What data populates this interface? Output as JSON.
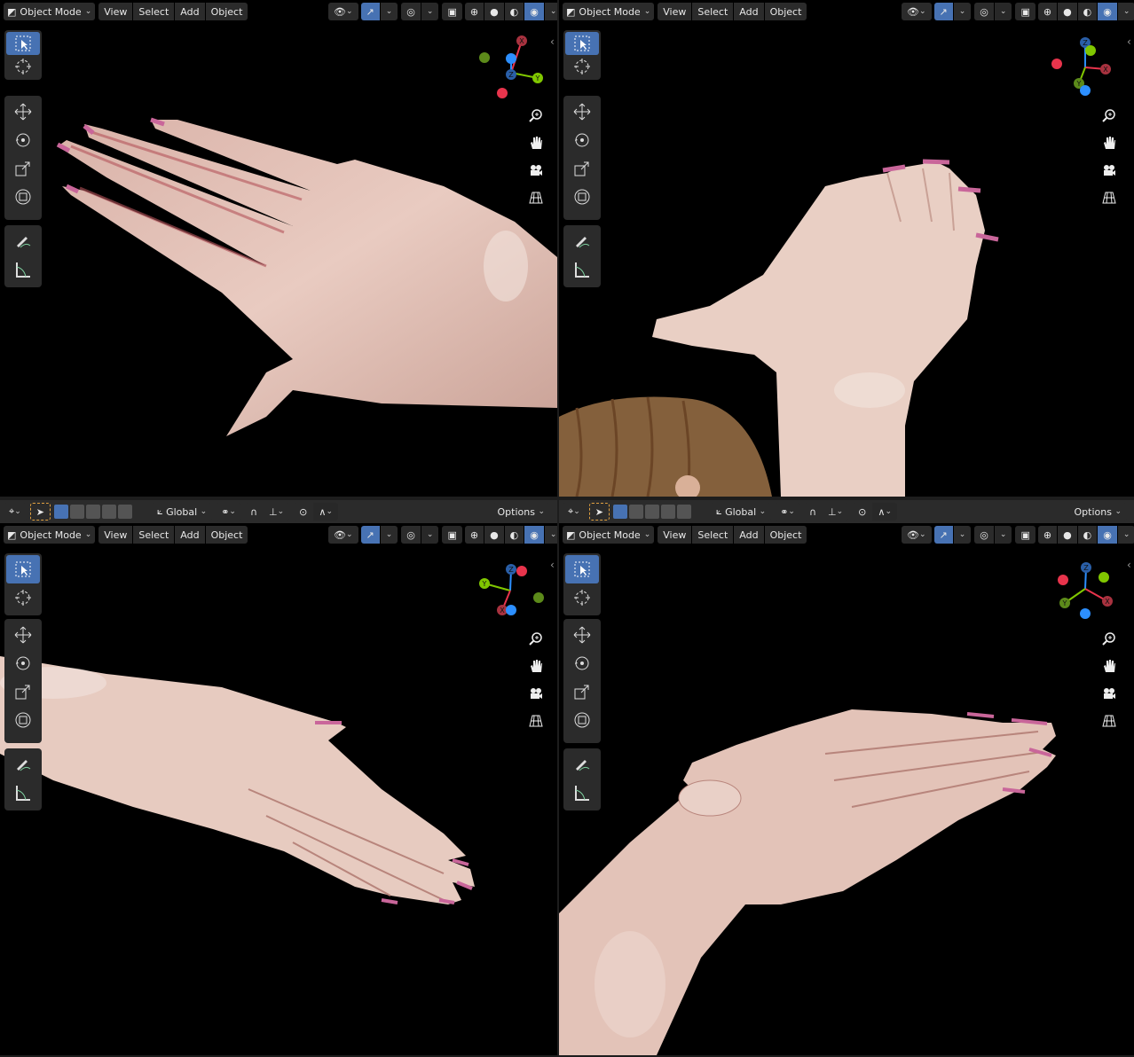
{
  "header": {
    "mode_label": "Object Mode",
    "menu": [
      "View",
      "Select",
      "Add",
      "Object"
    ]
  },
  "bottom_bar": {
    "orientation_label": "Global",
    "options_label": "Options"
  },
  "gizmo_axes": {
    "x": "X",
    "y": "Y",
    "z": "Z"
  },
  "colors": {
    "accent": "#4772b3",
    "axis_x": "#e8344c",
    "axis_y": "#80c700",
    "axis_z": "#2c8fff",
    "skin": "#e8c9bf",
    "nail": "#c9669a"
  },
  "icons": {
    "toolbar": [
      "select-box-icon",
      "cursor-icon",
      "move-icon",
      "rotate-icon",
      "scale-icon",
      "transform-icon",
      "annotate-icon",
      "measure-icon"
    ],
    "navigation": [
      "zoom-icon",
      "pan-hand-icon",
      "camera-icon",
      "perspective-grid-icon"
    ]
  }
}
